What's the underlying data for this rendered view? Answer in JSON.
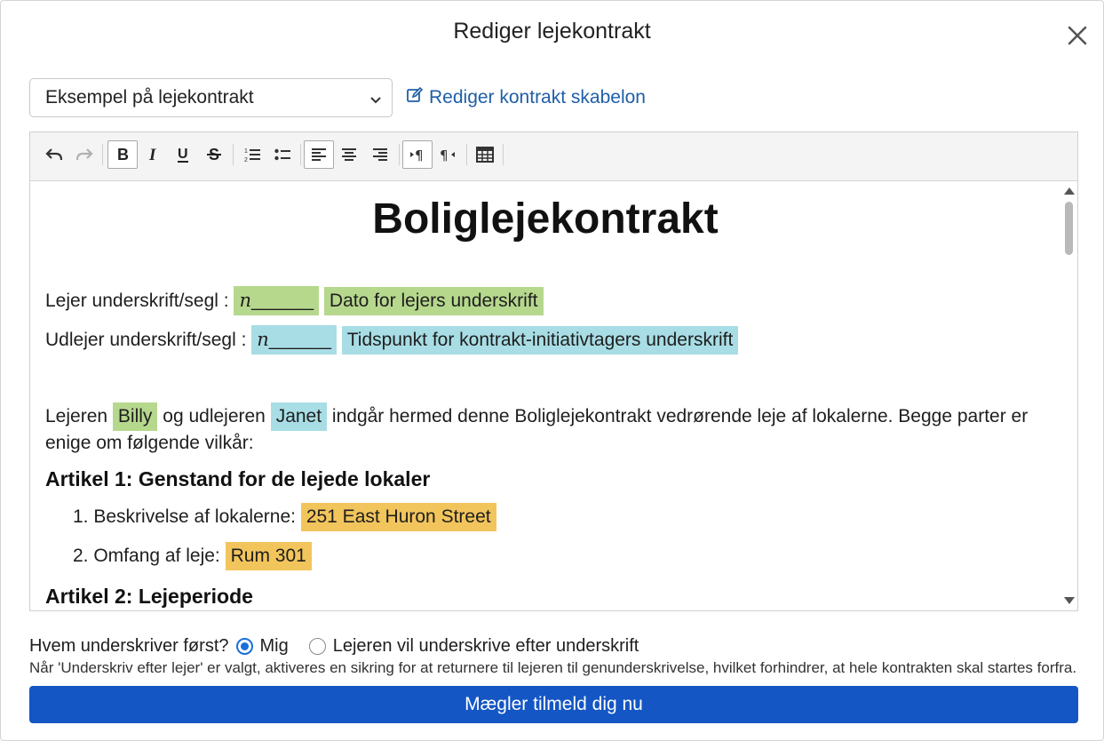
{
  "dialog": {
    "title": "Rediger lejekontrakt"
  },
  "template_select": {
    "selected": "Eksempel på lejekontrakt"
  },
  "edit_template_link": {
    "label": "Rediger kontrakt skabelon"
  },
  "toolbar": {
    "buttons": [
      "undo",
      "redo",
      "bold",
      "italic",
      "underline",
      "strikethrough",
      "ordered-list",
      "bullet-list",
      "align-left",
      "align-center",
      "align-right",
      "ltr",
      "rtl",
      "table"
    ],
    "active": [
      "bold",
      "align-left",
      "ltr"
    ]
  },
  "document": {
    "title": "Boliglejekontrakt",
    "tenant_sig_label": "Lejer underskrift/segl :",
    "tenant_sig_field": "______",
    "tenant_sig_mark": "n",
    "tenant_date_field": "Dato for lejers underskrift",
    "landlord_sig_label": "Udlejer underskrift/segl :",
    "landlord_sig_field": "______",
    "landlord_sig_mark": "n",
    "landlord_time_field": "Tidspunkt for kontrakt-initiativtagers underskrift",
    "intro_prefix": "Lejeren",
    "tenant_name": "Billy",
    "intro_mid": "og udlejeren",
    "landlord_name": "Janet",
    "intro_suffix": "indgår hermed denne Boliglejekontrakt vedrørende leje af lokalerne. Begge parter er enige om følgende vilkår:",
    "article1_title": "Artikel 1: Genstand for de lejede lokaler",
    "item1_label": "1. Beskrivelse af lokalerne:",
    "item1_value": "251 East Huron Street",
    "item2_label": "2. Omfang af leje:",
    "item2_value": "Rum 301",
    "article2_title": "Artikel 2: Lejeperiode"
  },
  "signing_order": {
    "question": "Hvem underskriver først?",
    "option_me": "Mig",
    "option_tenant": "Lejeren vil underskrive efter underskrift",
    "selected": "Mig",
    "note": "Når 'Underskriv efter lejer' er valgt, aktiveres en sikring for at returnere til lejeren til genunderskrivelse, hvilket forhindrer, at hele kontrakten skal startes forfra."
  },
  "cta": {
    "label": "Mægler tilmeld dig nu"
  },
  "colors": {
    "accent": "#1456c4",
    "link": "#1f5ea8",
    "green": "#b6d88d",
    "cyan": "#a8dde5",
    "orange": "#f2c55c"
  }
}
